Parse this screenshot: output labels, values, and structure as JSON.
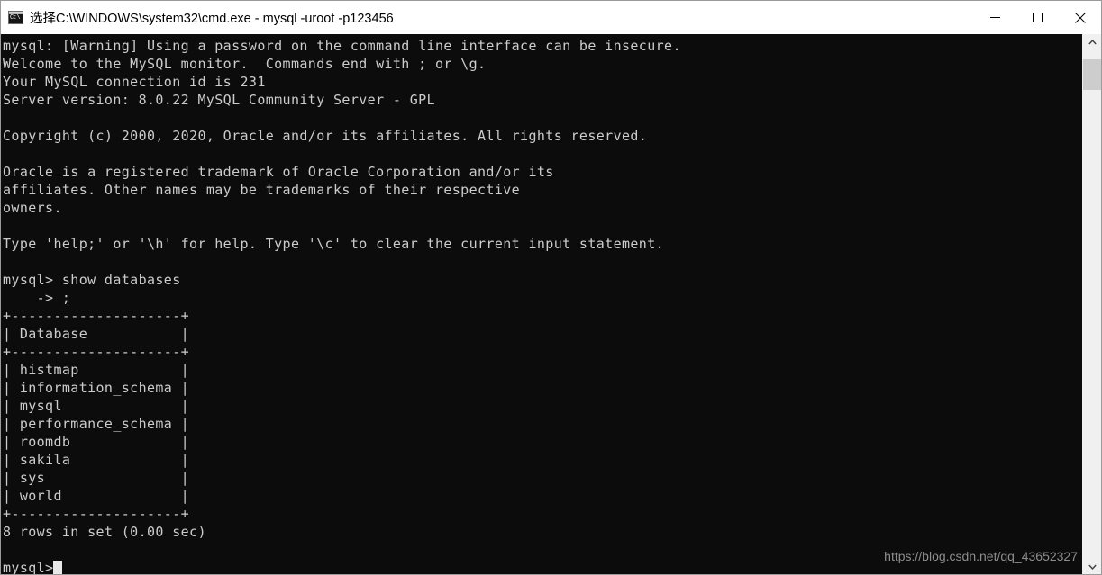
{
  "window": {
    "title": "选择C:\\WINDOWS\\system32\\cmd.exe - mysql  -uroot -p123456",
    "icon": "cmd-console-icon",
    "bg_color": "#0c0c0c",
    "fg_color": "#cccccc",
    "titlebar_color": "#ffffff",
    "controls": [
      {
        "name": "minimize",
        "glyph": "—"
      },
      {
        "name": "maximize",
        "glyph": "□"
      },
      {
        "name": "close",
        "glyph": "✕"
      }
    ]
  },
  "terminal": {
    "lines": [
      "mysql: [Warning] Using a password on the command line interface can be insecure.",
      "Welcome to the MySQL monitor.  Commands end with ; or \\g.",
      "Your MySQL connection id is 231",
      "Server version: 8.0.22 MySQL Community Server - GPL",
      "",
      "Copyright (c) 2000, 2020, Oracle and/or its affiliates. All rights reserved.",
      "",
      "Oracle is a registered trademark of Oracle Corporation and/or its",
      "affiliates. Other names may be trademarks of their respective",
      "owners.",
      "",
      "Type 'help;' or '\\h' for help. Type '\\c' to clear the current input statement.",
      "",
      "mysql> show databases",
      "    -> ;",
      "+--------------------+",
      "| Database           |",
      "+--------------------+",
      "| histmap            |",
      "| information_schema |",
      "| mysql              |",
      "| performance_schema |",
      "| roomdb             |",
      "| sakila             |",
      "| sys                |",
      "| world              |",
      "+--------------------+",
      "8 rows in set (0.00 sec)",
      "",
      "mysql>"
    ],
    "prompt": "mysql>",
    "cursor_visible": true,
    "command": "show databases",
    "continuation": "    -> ;",
    "result_summary": "8 rows in set (0.00 sec)",
    "server_version": "8.0.22 MySQL Community Server - GPL",
    "connection_id": "231",
    "query_result": {
      "type": "table",
      "columns": [
        "Database"
      ],
      "rows": [
        [
          "histmap"
        ],
        [
          "information_schema"
        ],
        [
          "mysql"
        ],
        [
          "performance_schema"
        ],
        [
          "roomdb"
        ],
        [
          "sakila"
        ],
        [
          "sys"
        ],
        [
          "world"
        ]
      ],
      "row_count": 8,
      "elapsed": "0.00 sec"
    }
  },
  "watermark": {
    "text": "https://blog.csdn.net/qq_43652327",
    "color": "#8d8d8d"
  },
  "scrollbar": {
    "up_arrow": "chevron-up-icon",
    "down_arrow": "chevron-down-icon",
    "thumb_position_pct": 2,
    "thumb_size_pct": 6
  }
}
